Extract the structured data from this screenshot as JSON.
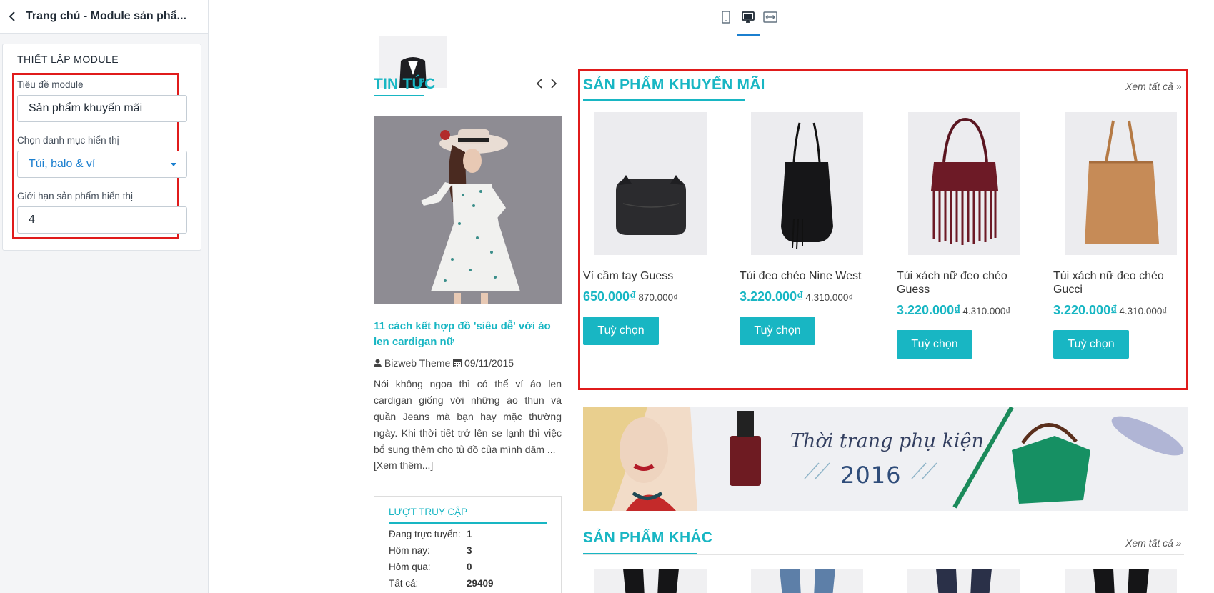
{
  "sidebar": {
    "title": "Trang chủ - Module sản phẩ...",
    "panel_title": "THIẾT LẬP MODULE",
    "module_title_label": "Tiêu đề module",
    "module_title_value": "Sản phẩm khuyến mãi",
    "category_label": "Chọn danh mục hiển thị",
    "category_value": "Túi, balo & ví",
    "limit_label": "Giới hạn sản phẩm hiển thị",
    "limit_value": "4"
  },
  "toolbar": {
    "icons": [
      "mobile-icon",
      "desktop-icon",
      "fullwidth-icon"
    ],
    "active": "desktop-icon"
  },
  "news": {
    "section_title": "TIN TỨC",
    "article_title": "11 cách kết hợp đồ 'siêu dễ' với áo len cardigan nữ",
    "author": "Bizweb Theme",
    "date": "09/11/2015",
    "excerpt": "Nói không ngoa thì có thể ví áo len cardigan giống với những áo thun và quần Jeans mà bạn hay mặc thường ngày. Khi thời tiết trở lên se lạnh thì việc bổ sung thêm cho tủ đồ của mình dăm ...",
    "read_more": "[Xem thêm...]"
  },
  "visits": {
    "title": "LƯỢT TRUY CẬP",
    "rows": [
      {
        "label": "Đang trực tuyến:",
        "value": "1"
      },
      {
        "label": "Hôm nay:",
        "value": "3"
      },
      {
        "label": "Hôm qua:",
        "value": "0"
      },
      {
        "label": "Tất cả:",
        "value": "29409"
      }
    ]
  },
  "promo": {
    "section_title": "SẢN PHẨM KHUYẾN MÃI",
    "see_all": "Xem tất cả »",
    "products": [
      {
        "name": "Ví cầm tay Guess",
        "price": "650.000₫",
        "old_price": "870.000₫",
        "button": "Tuỳ chọn"
      },
      {
        "name": "Túi đeo chéo Nine West",
        "price": "3.220.000₫",
        "old_price": "4.310.000₫",
        "button": "Tuỳ chọn"
      },
      {
        "name": "Túi xách nữ đeo chéo Guess",
        "price": "3.220.000₫",
        "old_price": "4.310.000₫",
        "button": "Tuỳ chọn"
      },
      {
        "name": "Túi xách nữ đeo chéo Gucci",
        "price": "3.220.000₫",
        "old_price": "4.310.000₫",
        "button": "Tuỳ chọn"
      }
    ]
  },
  "banner": {
    "line1": "Thời trang phụ kiện",
    "line2": "2016"
  },
  "other": {
    "section_title": "SẢN PHẨM KHÁC",
    "see_all": "Xem tất cả »"
  },
  "colors": {
    "accent": "#18b6c3",
    "highlight_border": "#e01b1b",
    "link_blue": "#1b7fcf"
  }
}
